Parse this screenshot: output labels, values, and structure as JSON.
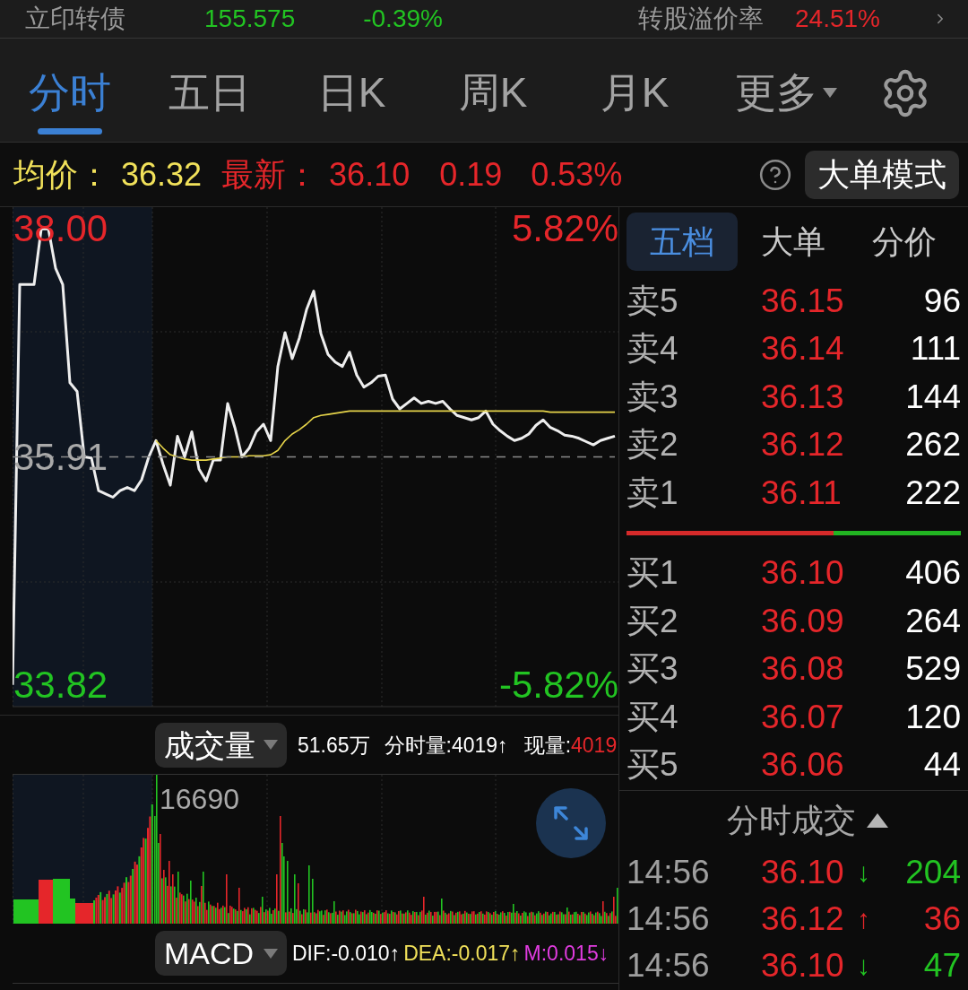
{
  "quote": {
    "name": "立印转债",
    "price": "155.575",
    "change": "-0.39%",
    "premium_label": "转股溢价率",
    "premium": "24.51%"
  },
  "tabs": [
    {
      "label": "分时",
      "selected": true,
      "kind": "tab"
    },
    {
      "label": "五日",
      "selected": false,
      "kind": "tab"
    },
    {
      "label": "日K",
      "selected": false,
      "kind": "tab"
    },
    {
      "label": "周K",
      "selected": false,
      "kind": "tab"
    },
    {
      "label": "月K",
      "selected": false,
      "kind": "tab"
    },
    {
      "label": "更多",
      "selected": false,
      "kind": "dropdown"
    }
  ],
  "summary": {
    "avg_label": "均价：",
    "avg": "36.32",
    "latest_label": "最新：",
    "latest": "36.10",
    "change": "0.19",
    "change_pct": "0.53%",
    "mode_button": "大单模式"
  },
  "price_chart": {
    "pct_high": "5.82%",
    "pct_low": "-5.82%",
    "chart_data": {
      "type": "line",
      "ylim": [
        33.62,
        38.2
      ],
      "yticks": [
        {
          "value": 38,
          "label": "38.00"
        },
        {
          "value": 35.91,
          "label": "35.91"
        },
        {
          "value": 33.82,
          "label": "33.82"
        }
      ],
      "series": [
        {
          "color": "#eeeeee",
          "line_style": "solid",
          "values": [
            33.82,
            37.49,
            37.49,
            37.49,
            38.0,
            38.0,
            37.64,
            37.49,
            36.59,
            36.51,
            35.91,
            35.9,
            35.6,
            35.57,
            35.54,
            35.6,
            35.63,
            35.6,
            35.7,
            35.91,
            36.06,
            35.84,
            35.65,
            36.1,
            35.91,
            36.14,
            35.8,
            35.69,
            35.88,
            35.88,
            36.4,
            36.18,
            35.91,
            35.99,
            36.14,
            36.21,
            36.06,
            36.74,
            37.05,
            36.81,
            37.0,
            37.26,
            37.43,
            37.04,
            36.85,
            36.78,
            36.74,
            36.87,
            36.66,
            36.55,
            36.59,
            36.65,
            36.66,
            36.44,
            36.35,
            36.4,
            36.45,
            36.4,
            36.42,
            36.4,
            36.42,
            36.35,
            36.29,
            36.27,
            36.25,
            36.27,
            36.33,
            36.21,
            36.15,
            36.1,
            36.06,
            36.08,
            36.12,
            36.2,
            36.25,
            36.18,
            36.15,
            36.11,
            36.1,
            36.08,
            36.05,
            36.02,
            36.06,
            36.08,
            36.1
          ]
        },
        {
          "color": "#e6d44a",
          "line_style": "solid",
          "values": [
            null,
            null,
            null,
            null,
            null,
            null,
            null,
            null,
            null,
            null,
            null,
            null,
            null,
            null,
            null,
            null,
            null,
            null,
            null,
            null,
            36.06,
            35.99,
            35.93,
            35.91,
            35.89,
            35.88,
            35.88,
            35.88,
            35.89,
            35.9,
            35.91,
            35.91,
            35.91,
            35.92,
            35.92,
            35.92,
            35.93,
            35.97,
            36.06,
            36.12,
            36.16,
            36.21,
            36.27,
            36.29,
            36.3,
            36.31,
            36.32,
            36.33,
            36.33,
            36.33,
            36.33,
            36.33,
            36.33,
            36.33,
            36.33,
            36.33,
            36.33,
            36.33,
            36.33,
            36.33,
            36.33,
            36.33,
            36.33,
            36.33,
            36.33,
            36.33,
            36.33,
            36.33,
            36.33,
            36.33,
            36.33,
            36.33,
            36.33,
            36.33,
            36.33,
            36.32,
            36.32,
            36.32,
            36.32,
            36.32,
            36.32,
            36.32,
            36.32,
            36.32,
            36.32
          ]
        },
        {
          "color": "#8a8a8a",
          "line_style": "dashed",
          "values": [
            35.91,
            35.91,
            35.91,
            35.91,
            35.91,
            35.91,
            35.91,
            35.91,
            35.91,
            35.91,
            35.91,
            35.91,
            35.91,
            35.91,
            35.91,
            35.91,
            35.91,
            35.91,
            35.91,
            35.91,
            35.91,
            35.91,
            35.91,
            35.91,
            35.91,
            35.91,
            35.91,
            35.91,
            35.91,
            35.91,
            35.91,
            35.91,
            35.91,
            35.91,
            35.91,
            35.91,
            35.91,
            35.91,
            35.91,
            35.91,
            35.91,
            35.91,
            35.91,
            35.91,
            35.91,
            35.91,
            35.91,
            35.91,
            35.91,
            35.91,
            35.91,
            35.91,
            35.91,
            35.91,
            35.91,
            35.91,
            35.91,
            35.91,
            35.91,
            35.91,
            35.91,
            35.91,
            35.91,
            35.91,
            35.91,
            35.91,
            35.91,
            35.91,
            35.91,
            35.91,
            35.91,
            35.91,
            35.91,
            35.91,
            35.91,
            35.91,
            35.91,
            35.91,
            35.91,
            35.91,
            35.91,
            35.91,
            35.91,
            35.91,
            35.91
          ]
        }
      ]
    }
  },
  "volume": {
    "selector": "成交量",
    "total": "51.65万",
    "minute": "分时量:4019↑",
    "current_label": "现量:",
    "current": "4019",
    "max_label": "16690"
  },
  "macd": {
    "selector": "MACD",
    "dif": "DIF:-0.010↑",
    "dea": "DEA:-0.017↑",
    "m": "M:0.015↓"
  },
  "order_book": {
    "tabs": [
      {
        "label": "五档",
        "selected": true
      },
      {
        "label": "大单",
        "selected": false
      },
      {
        "label": "分价",
        "selected": false
      }
    ],
    "asks": [
      {
        "label": "卖5",
        "price": "36.15",
        "volume": "96"
      },
      {
        "label": "卖4",
        "price": "36.14",
        "volume": "111"
      },
      {
        "label": "卖3",
        "price": "36.13",
        "volume": "144"
      },
      {
        "label": "卖2",
        "price": "36.12",
        "volume": "262"
      },
      {
        "label": "卖1",
        "price": "36.11",
        "volume": "222"
      }
    ],
    "ratio_bar": {
      "level": 0.62
    },
    "bids": [
      {
        "label": "买1",
        "price": "36.10",
        "volume": "406"
      },
      {
        "label": "买2",
        "price": "36.09",
        "volume": "264"
      },
      {
        "label": "买3",
        "price": "36.08",
        "volume": "529"
      },
      {
        "label": "买4",
        "price": "36.07",
        "volume": "120"
      },
      {
        "label": "买5",
        "price": "36.06",
        "volume": "44"
      }
    ]
  },
  "trades": {
    "title": "分时成交",
    "rows": [
      {
        "time": "14:56",
        "price": "36.10",
        "arrow": "↓",
        "volume": "204",
        "kind": "down"
      },
      {
        "time": "14:56",
        "price": "36.12",
        "arrow": "↑",
        "volume": "36",
        "kind": "up"
      },
      {
        "time": "14:56",
        "price": "36.10",
        "arrow": "↓",
        "volume": "47",
        "kind": "down"
      }
    ]
  }
}
